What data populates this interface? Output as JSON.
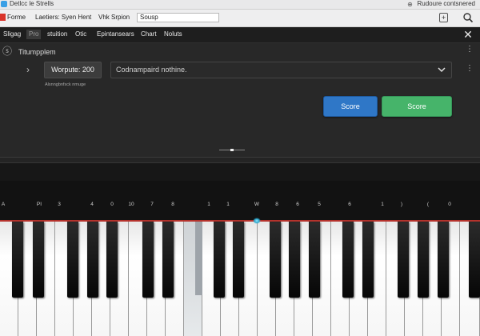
{
  "titlebar": {
    "title": "Detlcc le Strells",
    "right": "Rudoure   contsnered",
    "right_icon": "⊕"
  },
  "menubar": {
    "items": [
      "Forme",
      "Laetiers: Syen Hent",
      "Vhk",
      "Srpion"
    ],
    "search_value": "Sousp",
    "plus_label": "+"
  },
  "toolbar": {
    "tabs": [
      "Sligag",
      "Pro",
      "stuition",
      "Otic",
      "Epintansears",
      "Chart",
      "Noluts"
    ],
    "close_label": "✕"
  },
  "panel": {
    "icon": "ⓢ",
    "title": "Titumpplem",
    "wpm_label": "Worpute: 200",
    "dropdown_text": "Codnampaird nothine.",
    "hint": "Alsnngbnfsck nmuge",
    "score_blue": "Score",
    "score_green": "Score"
  },
  "notes": [
    "A",
    "PI",
    "3",
    "4",
    "0",
    "10",
    "7",
    "8",
    "1",
    "1",
    "W",
    "8",
    "6",
    "5",
    "6",
    "1",
    ")",
    "(",
    "0"
  ],
  "colors": {
    "accent_blue": "#2f77c7",
    "accent_green": "#46b46a",
    "red_line": "#b5322c"
  }
}
